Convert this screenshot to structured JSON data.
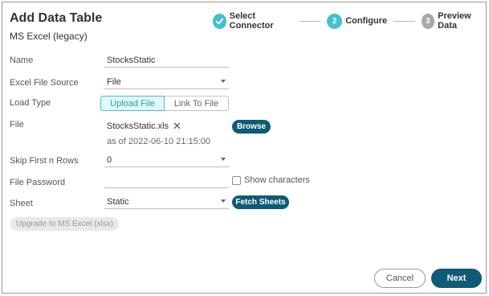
{
  "dialog": {
    "title": "Add Data Table",
    "subtitle": "MS Excel (legacy)"
  },
  "steps": [
    {
      "number": "1",
      "label": "Select Connector",
      "state": "done",
      "icon": "check-icon"
    },
    {
      "number": "2",
      "label": "Configure",
      "state": "active"
    },
    {
      "number": "3",
      "label": "Preview Data",
      "state": "pending"
    }
  ],
  "form": {
    "name": {
      "label": "Name",
      "value": "StocksStatic"
    },
    "source": {
      "label": "Excel File Source",
      "value": "File"
    },
    "load_type": {
      "label": "Load Type",
      "options": [
        "Upload File",
        "Link To File"
      ],
      "selected": "Upload File"
    },
    "file": {
      "label": "File",
      "file_name": "StocksStatic.xls",
      "remove_icon": "close-icon",
      "timestamp": "as of 2022-06-10 21:15:00",
      "browse_label": "Browse"
    },
    "skip_rows": {
      "label": "Skip First n Rows",
      "value": "0"
    },
    "password": {
      "label": "File Password",
      "value": "",
      "show_label": "Show characters",
      "show_checked": false
    },
    "sheet": {
      "label": "Sheet",
      "value": "Static",
      "fetch_label": "Fetch Sheets"
    },
    "upgrade_label": "Upgrade to MS Excel (xlsx)"
  },
  "footer": {
    "cancel_label": "Cancel",
    "next_label": "Next"
  },
  "colors": {
    "accent": "#45c0cc",
    "primary": "#0f5a77",
    "pending": "#a8a8a8"
  }
}
